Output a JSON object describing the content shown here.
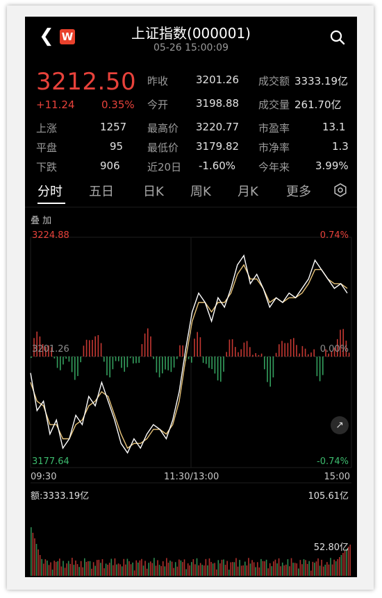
{
  "header": {
    "back_icon": "chevron-left-icon",
    "logo_text": "W",
    "title": "上证指数(000001)",
    "datetime": "05-26 15:00:09",
    "search_icon": "search-icon"
  },
  "quote": {
    "price": "3212.50",
    "change": "+11.24",
    "change_pct": "0.35%",
    "stats": [
      {
        "label": "昨收",
        "value": "3201.26"
      },
      {
        "label": "成交额",
        "value": "3333.19亿"
      },
      {
        "label": "今开",
        "value": "3198.88"
      },
      {
        "label": "成交量",
        "value": "261.70亿"
      },
      {
        "label": "上涨",
        "value": "1257"
      },
      {
        "label": "最高价",
        "value": "3220.77"
      },
      {
        "label": "市盈率",
        "value": "13.1"
      },
      {
        "label": "平盘",
        "value": "95"
      },
      {
        "label": "最低价",
        "value": "3179.82"
      },
      {
        "label": "市净率",
        "value": "1.3"
      },
      {
        "label": "下跌",
        "value": "906"
      },
      {
        "label": "近20日",
        "value": "-1.60%"
      },
      {
        "label": "今年来",
        "value": "3.99%"
      }
    ]
  },
  "tabs": [
    "分时",
    "五日",
    "日K",
    "周K",
    "月K",
    "更多"
  ],
  "active_tab": "分时",
  "chart": {
    "overlay_label": "叠 加",
    "y_top": "3224.88",
    "y_mid": "3201.26",
    "y_bottom": "3177.64",
    "pct_top": "0.74%",
    "pct_mid": "0.00%",
    "pct_bottom": "-0.74%",
    "x_start": "09:30",
    "x_mid": "11:30/13:00",
    "x_end": "15:00",
    "amount_label": "额:3333.19亿",
    "vol_max": "105.61亿",
    "vol_mid": "52.80亿"
  },
  "colors": {
    "up": "#e8423b",
    "down": "#3dbb6e",
    "price_line": "#ffffff",
    "avg_line": "#e8c47a"
  },
  "chart_data": {
    "type": "line",
    "x_axis_ticks": [
      "09:30",
      "11:30/13:00",
      "15:00"
    ],
    "ylim": [
      3177.64,
      3224.88
    ],
    "series": [
      {
        "values": [
          3196,
          3188,
          3190,
          3183,
          3186,
          3180,
          3182,
          3187,
          3185,
          3191,
          3189,
          3194,
          3190,
          3186,
          3181,
          3179,
          3182,
          3180,
          3183,
          3185,
          3184,
          3182,
          3186,
          3192,
          3201,
          3209,
          3213,
          3211,
          3207,
          3212,
          3210,
          3214,
          3219,
          3221,
          3215,
          3217,
          3214,
          3210,
          3212,
          3211,
          3213,
          3212,
          3214,
          3216,
          3220,
          3218,
          3216,
          3214,
          3215,
          3213
        ]
      },
      {
        "values": [
          3194,
          3190,
          3189,
          3185,
          3185,
          3182,
          3182,
          3185,
          3186,
          3189,
          3190,
          3192,
          3191,
          3187,
          3183,
          3180,
          3181,
          3181,
          3182,
          3184,
          3184,
          3183,
          3185,
          3190,
          3199,
          3207,
          3211,
          3211,
          3209,
          3211,
          3211,
          3213,
          3217,
          3219,
          3216,
          3216,
          3214,
          3211,
          3212,
          3211,
          3212,
          3212,
          3213,
          3215,
          3218,
          3218,
          3216,
          3215,
          3215,
          3214
        ]
      }
    ]
  }
}
